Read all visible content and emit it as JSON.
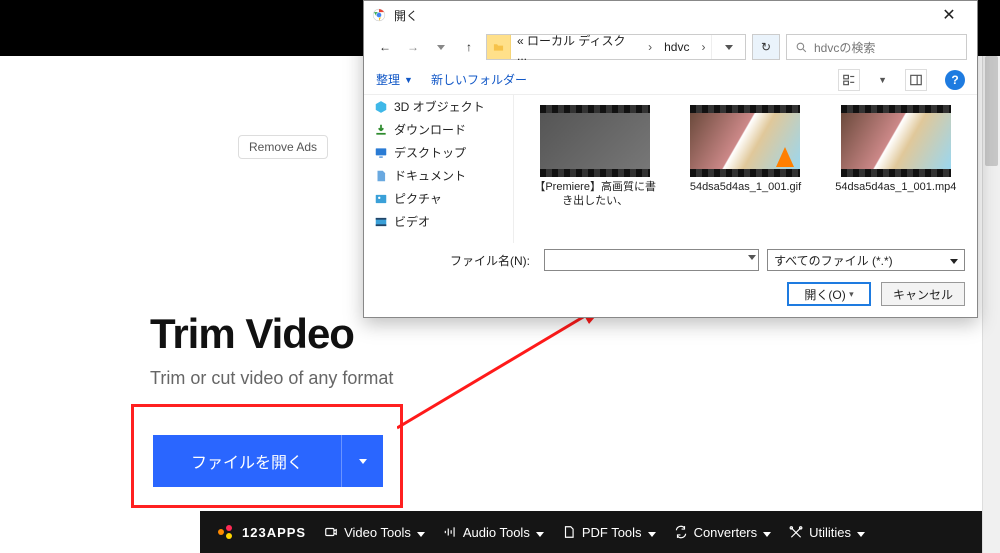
{
  "page": {
    "title": "Trim Video",
    "subtitle": "Trim or cut video of any format",
    "remove_ads": "Remove Ads",
    "open_file_label": "ファイルを開く"
  },
  "bottombar": {
    "logo": "123APPS",
    "items": [
      "Video Tools",
      "Audio Tools",
      "PDF Tools",
      "Converters",
      "Utilities"
    ]
  },
  "dialog": {
    "title": "開く",
    "breadcrumb_prefix": "«  ローカル ディスク ...",
    "breadcrumb_current": "hdvc",
    "search_placeholder": "hdvcの検索",
    "organize": "整理",
    "new_folder": "新しいフォルダー",
    "tree": [
      "3D オブジェクト",
      "ダウンロード",
      "デスクトップ",
      "ドキュメント",
      "ピクチャ",
      "ビデオ"
    ],
    "files": [
      {
        "label": "【Premiere】高画質に書き出したい、"
      },
      {
        "label": "54dsa5d4as_1_001.gif"
      },
      {
        "label": "54dsa5d4as_1_001.mp4"
      }
    ],
    "filename_label": "ファイル名(N):",
    "filetype_value": "すべてのファイル (*.*)",
    "open_btn": "開く(O)",
    "cancel_btn": "キャンセル"
  }
}
